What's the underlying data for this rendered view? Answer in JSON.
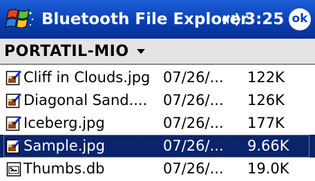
{
  "title_bar": {
    "start_icon": "windows-flag-icon",
    "app_title": "Bluetooth File Explorer",
    "volume_icon": "speaker-icon",
    "time": "3:25",
    "ok_label": "ok",
    "color": "#0a3fb4"
  },
  "path_bar": {
    "device_name": "PORTATIL-MIO",
    "dropdown_icon": "chevron-down-icon"
  },
  "files": [
    {
      "name": "Cliff in Clouds.jpg",
      "date": "07/26/...",
      "size": "122K",
      "icon": "image-file-icon",
      "selected": false
    },
    {
      "name": "Diagonal Sand....",
      "date": "07/26/...",
      "size": "126K",
      "icon": "image-file-icon",
      "selected": false
    },
    {
      "name": "Iceberg.jpg",
      "date": "07/26/...",
      "size": "177K",
      "icon": "image-file-icon",
      "selected": false
    },
    {
      "name": "Sample.jpg",
      "date": "07/26/...",
      "size": "9.66K",
      "icon": "image-file-icon",
      "selected": true
    },
    {
      "name": "Thumbs.db",
      "date": "07/26/...",
      "size": "19.0K",
      "icon": "db-file-icon",
      "selected": false
    }
  ],
  "colors": {
    "title_bar": "#0a3fb4",
    "selection": "#0a246a",
    "path_bar": "#e4e4e4"
  }
}
